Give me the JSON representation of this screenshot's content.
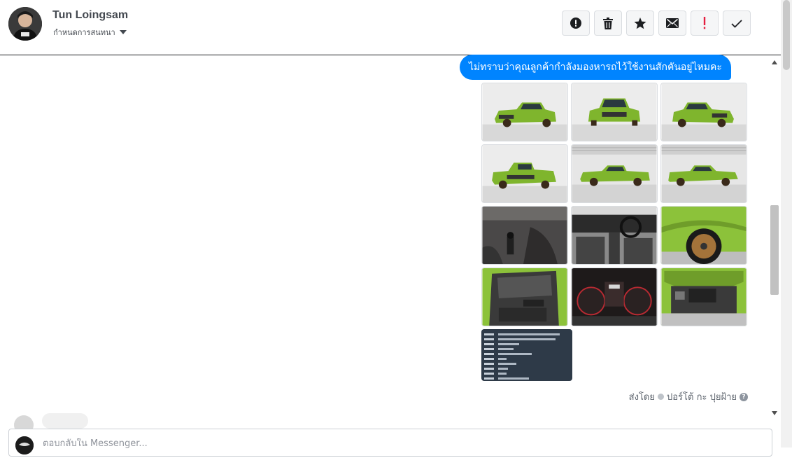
{
  "header": {
    "contact_name": "Tun Loingsam",
    "assign_label": "กำหนดการสนทนา",
    "toolbar": [
      {
        "name": "mark-spam-button",
        "icon": "alert-circle-icon"
      },
      {
        "name": "delete-button",
        "icon": "trash-icon"
      },
      {
        "name": "star-button",
        "icon": "star-icon"
      },
      {
        "name": "mark-unread-button",
        "icon": "envelope-icon"
      },
      {
        "name": "mark-important-button",
        "icon": "exclamation-icon"
      },
      {
        "name": "mark-done-button",
        "icon": "check-icon"
      }
    ]
  },
  "message": {
    "text": "ไม่ทราบว่าคุณลูกค้ากำลังมองหารถไว้ใช้งานสักคันอยู่ไหมคะ",
    "bubble_color": "#0084ff",
    "photo_count": 13,
    "sent_by_prefix": "ส่งโดย",
    "sent_by_name": "ปอร์โต้ กะ ปุยฝ้าย",
    "help_icon": "?"
  },
  "reply": {
    "placeholder": "ตอบกลับใน Messenger..."
  },
  "colors": {
    "accent": "#0084ff",
    "car_green": "#7fb52d",
    "important_red": "#e41e3f"
  }
}
